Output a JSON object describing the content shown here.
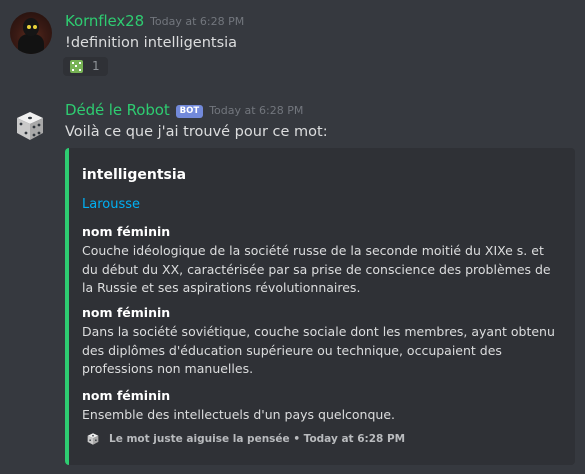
{
  "messages": [
    {
      "username": "Kornflex28",
      "timestamp": "Today at 6:28 PM",
      "content": "!definition intelligentsia",
      "reaction": {
        "icon": "green-dice-emoji",
        "count": "1"
      },
      "avatar": "dark-creature-avatar"
    },
    {
      "username": "Dédé le Robot",
      "tag": "BOT",
      "timestamp": "Today at 6:28 PM",
      "content": "Voilà ce que j'ai trouvé pour ce mot:",
      "avatar": "dice-avatar",
      "embed": {
        "title": "intelligentsia",
        "link": "Larousse",
        "fields": [
          {
            "name": "nom féminin",
            "value": "Couche idéologique de la société russe de la seconde moitié du XIXe s. et du début du XX, caractérisée par sa prise de conscience des problèmes de la Russie et ses aspirations révolutionnaires."
          },
          {
            "name": "nom féminin",
            "value": "Dans la société soviétique, couche sociale dont les membres, ayant obtenu des diplômes d'éducation supérieure ou technique, occupaient des professions non manuelles."
          },
          {
            "name": "nom féminin",
            "value": "Ensemble des intellectuels d'un pays quelconque."
          }
        ],
        "footer": "Le mot juste aiguise la pensée • Today at 6:28 PM"
      }
    }
  ],
  "colors": {
    "background": "#36393f",
    "embed_background": "#2f3136",
    "accent_green": "#2ecc71",
    "link_blue": "#00b0f4",
    "bot_tag": "#7289da"
  }
}
